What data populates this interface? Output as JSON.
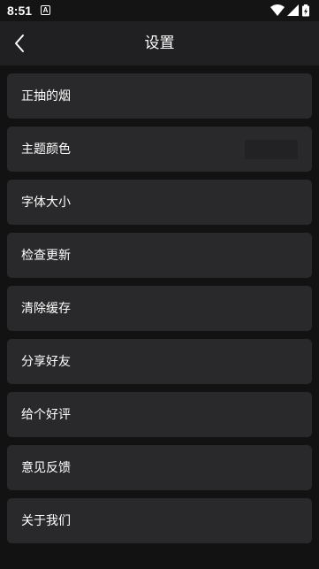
{
  "status_bar": {
    "time": "8:51",
    "notification_letter": "A",
    "icons": [
      "wifi-icon",
      "cellular-signal-icon",
      "battery-charging-icon"
    ]
  },
  "header": {
    "title": "设置",
    "back_icon": "chevron-left-icon"
  },
  "settings": {
    "items": [
      {
        "id": "smoking",
        "label": "正抽的烟"
      },
      {
        "id": "theme-color",
        "label": "主题颜色",
        "swatch_color": "#222224"
      },
      {
        "id": "font-size",
        "label": "字体大小"
      },
      {
        "id": "check-update",
        "label": "检查更新"
      },
      {
        "id": "clear-cache",
        "label": "清除缓存"
      },
      {
        "id": "share-friends",
        "label": "分享好友"
      },
      {
        "id": "rate-app",
        "label": "给个好评"
      },
      {
        "id": "feedback",
        "label": "意见反馈"
      },
      {
        "id": "about-us",
        "label": "关于我们"
      }
    ]
  },
  "colors": {
    "background": "#121212",
    "app_bar": "#202022",
    "card": "#29292b",
    "text": "#ffffff"
  }
}
